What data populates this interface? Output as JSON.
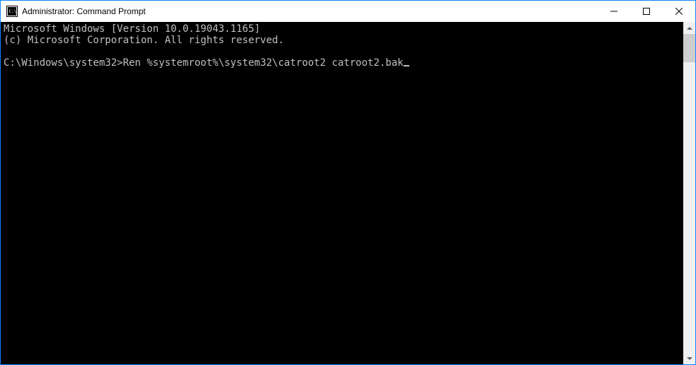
{
  "window": {
    "title": "Administrator: Command Prompt"
  },
  "terminal": {
    "line1": "Microsoft Windows [Version 10.0.19043.1165]",
    "line2": "(c) Microsoft Corporation. All rights reserved.",
    "blank": "",
    "prompt": "C:\\Windows\\system32>",
    "command": "Ren %systemroot%\\system32\\catroot2 catroot2.bak"
  },
  "icons": {
    "app": "cmd-icon",
    "minimize": "minimize-icon",
    "maximize": "maximize-icon",
    "close": "close-icon",
    "scroll_up": "scroll-up-icon",
    "scroll_down": "scroll-down-icon"
  }
}
